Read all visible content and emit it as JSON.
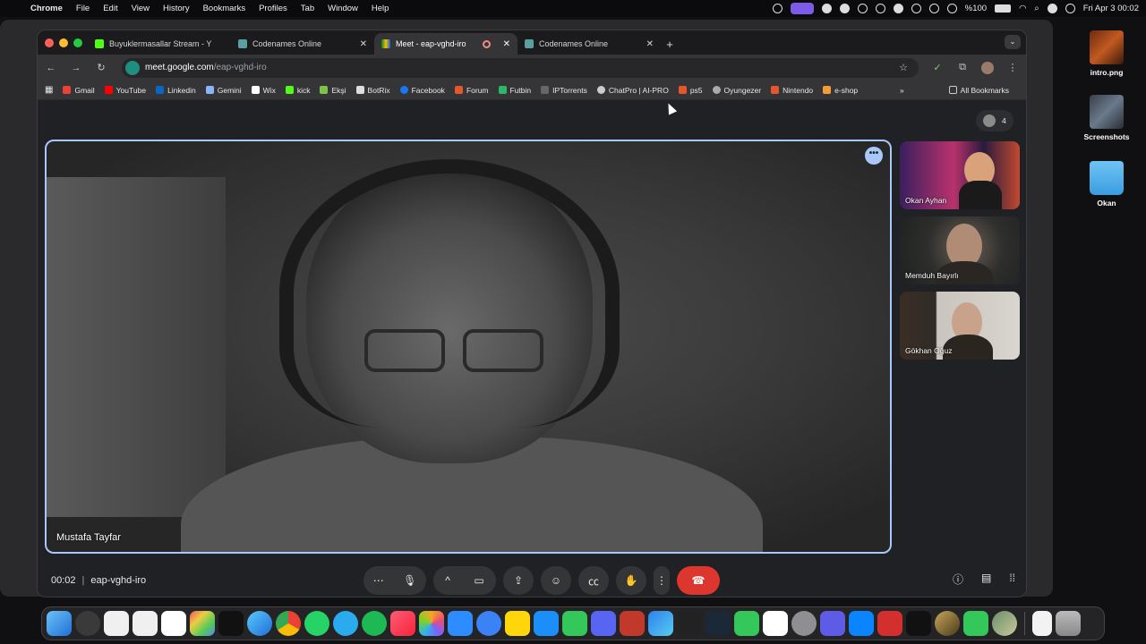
{
  "menubar": {
    "app": "Chrome",
    "items": [
      "File",
      "Edit",
      "View",
      "History",
      "Bookmarks",
      "Profiles",
      "Tab",
      "Window",
      "Help"
    ],
    "battery": "%100",
    "datetime": "Fri Apr 3  00:02"
  },
  "desktop": {
    "icons": [
      "intro.png",
      "Screenshots",
      "Okan"
    ]
  },
  "browser": {
    "tabs": [
      {
        "title": "Buyuklermasallar Stream - Y"
      },
      {
        "title": "Codenames Online"
      },
      {
        "title": "Meet - eap-vghd-iro"
      },
      {
        "title": "Codenames Online"
      }
    ],
    "url_host": "meet.google.com",
    "url_path": "/eap-vghd-iro",
    "bookmarks": [
      "Gmail",
      "YouTube",
      "Linkedin",
      "Gemini",
      "Wix",
      "kick",
      "Ekşi",
      "BotRix",
      "Facebook",
      "Forum",
      "Futbin",
      "IPTorrents",
      "ChatPro | AI-PRO",
      "ps5",
      "Oyungezer",
      "Nintendo",
      "e-shop"
    ],
    "all_bookmarks": "All Bookmarks"
  },
  "meet": {
    "participant_count": "4",
    "main_speaker": "Mustafa Tayfar",
    "tiles": [
      "Okan Ayhan",
      "Memduh Bayırlı",
      "Gökhan Oğuz"
    ],
    "time": "00:02",
    "meeting_code": "eap-vghd-iro"
  },
  "colors": {
    "active_border": "#a8c7fa",
    "end_call": "#dc362e",
    "background": "#202124"
  }
}
